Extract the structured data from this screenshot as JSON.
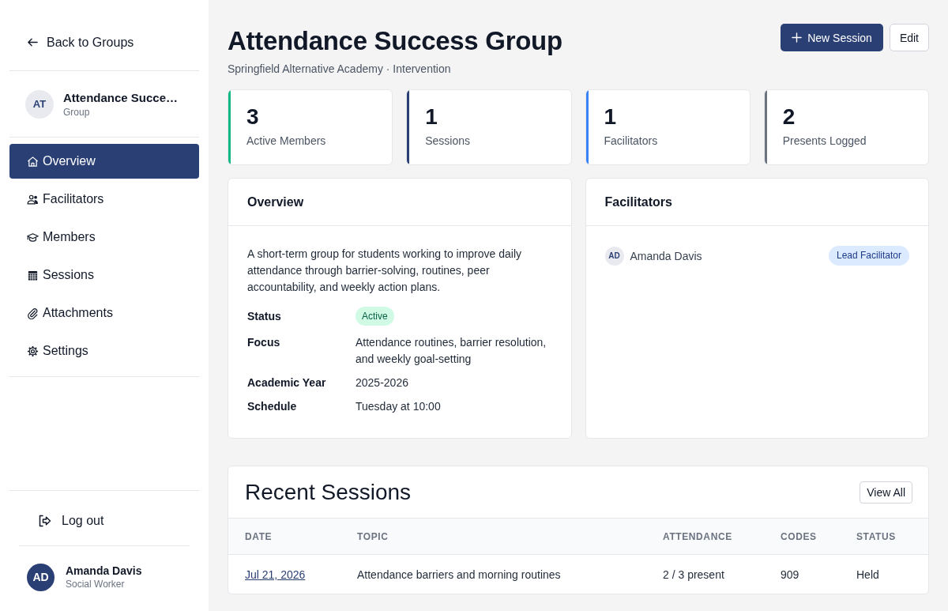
{
  "sidebar": {
    "back_link": "Back to Groups",
    "group": {
      "initials": "AT",
      "name": "Attendance Succe…",
      "type": "Group"
    },
    "nav": [
      {
        "label": "Overview",
        "selected": true
      },
      {
        "label": "Facilitators",
        "selected": false
      },
      {
        "label": "Members",
        "selected": false
      },
      {
        "label": "Sessions",
        "selected": false
      },
      {
        "label": "Attachments",
        "selected": false
      },
      {
        "label": "Settings",
        "selected": false
      }
    ],
    "logout": "Log out",
    "user": {
      "initials": "AD",
      "name": "Amanda Davis",
      "role": "Social Worker"
    }
  },
  "header": {
    "title": "Attendance Success Group",
    "subtitle": "Springfield Alternative Academy · Intervention",
    "buttons": [
      {
        "label": "New Session",
        "kind": "primary"
      },
      {
        "label": "Edit",
        "kind": "secondary"
      }
    ]
  },
  "stats": [
    {
      "value": "3",
      "label": "Active Members",
      "color": "#10b981"
    },
    {
      "value": "1",
      "label": "Sessions",
      "color": "#2a3f74"
    },
    {
      "value": "1",
      "label": "Facilitators",
      "color": "#3b82f6"
    },
    {
      "value": "2",
      "label": "Presents Logged",
      "color": "#6b7280"
    }
  ],
  "overview": {
    "title": "Overview",
    "description": "A short-term group for students working to improve daily attendance through barrier-solving, routines, peer accountability, and weekly action plans.",
    "fields": [
      {
        "label": "Status",
        "value": "Active",
        "kind": "badge"
      },
      {
        "label": "Focus",
        "value": "Attendance routines, barrier resolution, and weekly goal-setting",
        "kind": "text"
      },
      {
        "label": "Academic Year",
        "value": "2025-2026",
        "kind": "text"
      },
      {
        "label": "Schedule",
        "value": "Tuesday at 10:00",
        "kind": "text"
      }
    ]
  },
  "facilitators": {
    "title": "Facilitators",
    "items": [
      {
        "initials": "AD",
        "name": "Amanda Davis",
        "role": "Lead Facilitator"
      }
    ]
  },
  "recent_sessions": {
    "title": "Recent Sessions",
    "view_all": "View All",
    "columns": [
      "DATE",
      "TOPIC",
      "ATTENDANCE",
      "CODES",
      "STATUS"
    ],
    "rows": [
      {
        "date": "Jul 21, 2026",
        "topic": "Attendance barriers and morning routines",
        "attendance": "2 / 3 present",
        "codes": "909",
        "status": "Held"
      }
    ]
  }
}
